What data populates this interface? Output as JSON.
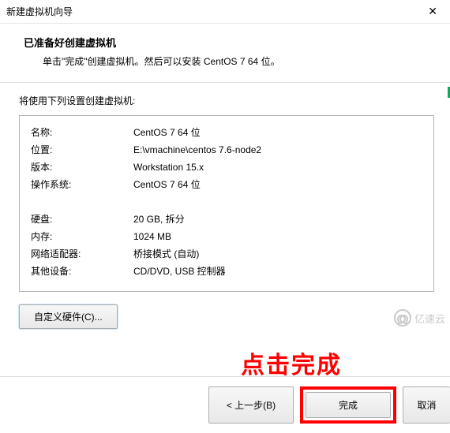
{
  "window": {
    "title": "新建虚拟机向导",
    "close_glyph": "✕"
  },
  "header": {
    "title": "已准备好创建虚拟机",
    "subtitle": "单击\"完成\"创建虚拟机。然后可以安装 CentOS 7 64 位。"
  },
  "body": {
    "lead": "将使用下列设置创建虚拟机:"
  },
  "props": {
    "name_label": "名称:",
    "name_value": "CentOS 7 64 位",
    "location_label": "位置:",
    "location_value": "E:\\vmachine\\centos 7.6-node2",
    "version_label": "版本:",
    "version_value": "Workstation 15.x",
    "os_label": "操作系统:",
    "os_value": "CentOS 7 64 位",
    "disk_label": "硬盘:",
    "disk_value": "20 GB, 拆分",
    "memory_label": "内存:",
    "memory_value": "1024 MB",
    "net_label": "网络适配器:",
    "net_value": "桥接模式 (自动)",
    "other_label": "其他设备:",
    "other_value": "CD/DVD, USB 控制器"
  },
  "buttons": {
    "customize": "自定义硬件(C)...",
    "back": "< 上一步(B)",
    "finish": "完成",
    "cancel": "取消"
  },
  "annotation": {
    "text": "点击完成"
  },
  "watermark": {
    "text": "亿速云"
  }
}
